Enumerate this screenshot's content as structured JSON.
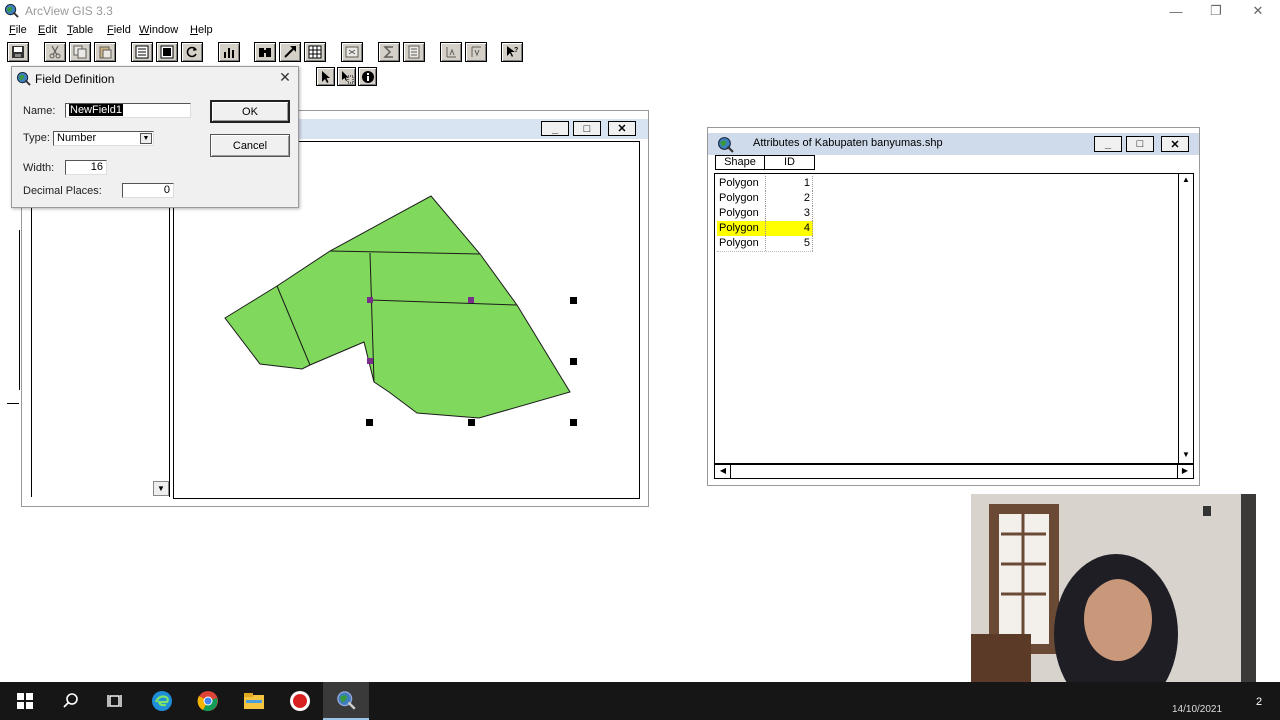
{
  "app": {
    "title": "ArcView GIS 3.3"
  },
  "window_controls": {
    "minimize": "—",
    "restore": "❐",
    "close": "✕"
  },
  "menu": [
    {
      "label": "File",
      "hotkey": "F",
      "rest": "ile"
    },
    {
      "label": "Edit",
      "hotkey": "E",
      "rest": "dit"
    },
    {
      "label": "Table",
      "hotkey": "T",
      "rest": "able"
    },
    {
      "label": "Field",
      "hotkey": "F",
      "rest": "ield"
    },
    {
      "label": "Window",
      "hotkey": "W",
      "rest": "indow"
    },
    {
      "label": "Help",
      "hotkey": "H",
      "rest": "elp"
    }
  ],
  "toolbar_icons": [
    "save-project-icon",
    "cut-icon",
    "copy-icon",
    "paste-icon",
    "table-properties-icon",
    "select-all-icon",
    "refresh-icon",
    "chart-icon",
    "find-icon",
    "query-icon",
    "table-grid-icon",
    "promote-icon",
    "summarize-icon",
    "calculate-icon",
    "sort-ascending-icon",
    "sort-descending-icon",
    "help-pointer-icon"
  ],
  "toolbar2_icons": [
    "pointer-icon",
    "select-tool-icon",
    "identify-icon"
  ],
  "dialog": {
    "title": "Field Definition",
    "name_label": "Name:",
    "name_value": "NewField1",
    "type_label": "Type:",
    "type_value": "Number",
    "width_label": "Width:",
    "width_value": "16",
    "decimals_label": "Decimal Places:",
    "decimals_value": "0",
    "ok_label": "OK",
    "cancel_label": "Cancel",
    "close_glyph": "✕"
  },
  "view_window": {
    "buttons": {
      "minimize": "_",
      "maximize": "□",
      "close": "✕"
    },
    "polygon_fill": "#80d95c",
    "polygon_stroke": "#1a1a1a",
    "selection_handle_color": "#000000",
    "vertex_color": "#7a2e8c"
  },
  "attributes_window": {
    "title": "Attributes of Kabupaten banyumas.shp",
    "columns": [
      "Shape",
      "ID"
    ],
    "rows": [
      {
        "shape": "Polygon",
        "id": "1",
        "selected": false
      },
      {
        "shape": "Polygon",
        "id": "2",
        "selected": false
      },
      {
        "shape": "Polygon",
        "id": "3",
        "selected": false
      },
      {
        "shape": "Polygon",
        "id": "4",
        "selected": true
      },
      {
        "shape": "Polygon",
        "id": "5",
        "selected": false
      }
    ],
    "highlight_color": "#ffff00",
    "buttons": {
      "minimize": "_",
      "maximize": "□",
      "close": "✕"
    }
  },
  "taskbar": {
    "icons": [
      "windows-start-icon",
      "search-icon",
      "task-view-icon",
      "edge-icon",
      "chrome-icon",
      "file-explorer-icon",
      "record-icon",
      "arcview-icon"
    ],
    "clock_date": "14/10/2021",
    "notification_count": "2",
    "background": "#161616"
  },
  "webcam_overlay": {
    "kind": "presenter-webcam"
  }
}
